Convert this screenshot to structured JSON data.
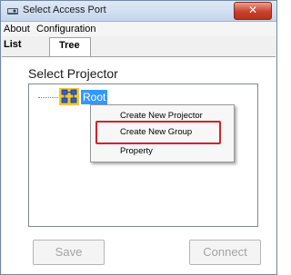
{
  "window": {
    "title": "Select Access Port"
  },
  "menu": {
    "items": [
      {
        "label": "About"
      },
      {
        "label": "Configuration"
      }
    ]
  },
  "tabs": [
    {
      "label": "List"
    },
    {
      "label": "Tree"
    }
  ],
  "panel": {
    "heading": "Select Projector"
  },
  "tree": {
    "root_label": "Root"
  },
  "context_menu": {
    "items": [
      {
        "label": "Create New Projector"
      },
      {
        "label": "Create New Group",
        "highlighted": true
      },
      {
        "label": "Property"
      }
    ]
  },
  "buttons": {
    "save": "Save",
    "connect": "Connect"
  },
  "colors": {
    "selection": "#3399ff",
    "highlight_border": "#d1222b",
    "close_button": "#c9412c"
  }
}
